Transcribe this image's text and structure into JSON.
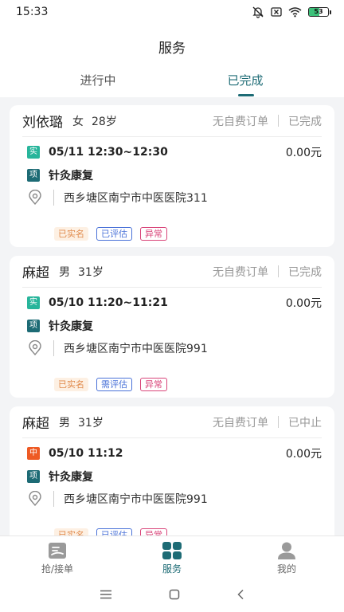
{
  "status_bar": {
    "time": "15:33",
    "battery": "53",
    "battery_level": 0.53,
    "icons": [
      "bell-mute-icon",
      "sim-x-icon",
      "wifi-icon",
      "battery-icon"
    ]
  },
  "header": {
    "title": "服务",
    "tabs": [
      {
        "label": "进行中",
        "active": false
      },
      {
        "label": "已完成",
        "active": true
      }
    ]
  },
  "orders": [
    {
      "name": "刘依璐",
      "gender": "女",
      "age": "28岁",
      "fee_status": "无自费订单",
      "status": "已完成",
      "type_badge": "实",
      "type_color": "#27b59b",
      "time": "05/11 12:30~12:30",
      "amount": "0.00元",
      "item_badge": "项",
      "item_color": "#1d6b75",
      "item": "针灸康复",
      "address": "西乡塘区南宁市中医医院311",
      "tags": [
        "已实名",
        "已评估",
        "异常"
      ]
    },
    {
      "name": "麻超",
      "gender": "男",
      "age": "31岁",
      "fee_status": "无自费订单",
      "status": "已完成",
      "type_badge": "实",
      "type_color": "#27b59b",
      "time": "05/10 11:20~11:21",
      "amount": "0.00元",
      "item_badge": "项",
      "item_color": "#1d6b75",
      "item": "针灸康复",
      "address": "西乡塘区南宁市中医医院991",
      "tags": [
        "已实名",
        "需评估",
        "异常"
      ]
    },
    {
      "name": "麻超",
      "gender": "男",
      "age": "31岁",
      "fee_status": "无自费订单",
      "status": "已中止",
      "type_badge": "中",
      "type_color": "#ee5a24",
      "time": "05/10 11:12",
      "amount": "0.00元",
      "item_badge": "项",
      "item_color": "#1d6b75",
      "item": "针灸康复",
      "address": "西乡塘区南宁市中医医院991",
      "tags": [
        "已实名",
        "已评估",
        "异常"
      ]
    }
  ],
  "bottom_nav": [
    {
      "label": "抢/接单",
      "icon": "grab-order-icon",
      "active": false
    },
    {
      "label": "服务",
      "icon": "service-grid-icon",
      "active": true
    },
    {
      "label": "我的",
      "icon": "profile-icon",
      "active": false
    }
  ],
  "colors": {
    "accent": "#1d6b75",
    "tag_real": "#e0894a",
    "tag_eval": "#4a72d8",
    "tag_abnormal": "#d9457a"
  }
}
